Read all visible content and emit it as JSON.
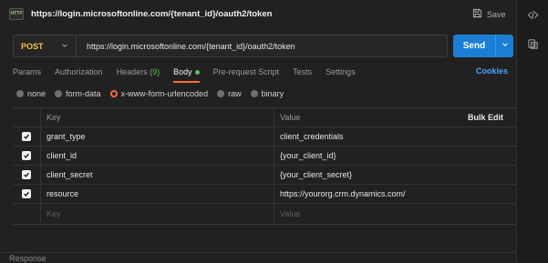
{
  "header": {
    "app_icon_text": "HTTP",
    "request_title": "https://login.microsoftonline.com/{tenant_id}/oauth2/token",
    "save_label": "Save"
  },
  "request": {
    "method": "POST",
    "url": "https://login.microsoftonline.com/{tenant_id}/oauth2/token",
    "send_label": "Send"
  },
  "tabs": [
    {
      "label": "Params"
    },
    {
      "label": "Authorization"
    },
    {
      "label": "Headers",
      "count": "(9)"
    },
    {
      "label": "Body",
      "active": true
    },
    {
      "label": "Pre-request Script"
    },
    {
      "label": "Tests"
    },
    {
      "label": "Settings"
    }
  ],
  "cookies_label": "Cookies",
  "body_types": [
    {
      "label": "none",
      "selected": false
    },
    {
      "label": "form-data",
      "selected": false
    },
    {
      "label": "x-www-form-urlencoded",
      "selected": true
    },
    {
      "label": "raw",
      "selected": false
    },
    {
      "label": "binary",
      "selected": false
    }
  ],
  "table": {
    "headers": {
      "key": "Key",
      "value": "Value",
      "bulk_edit": "Bulk Edit"
    },
    "rows": [
      {
        "key": "grant_type",
        "value": "client_credentials",
        "checked": true
      },
      {
        "key": "client_id",
        "value": "{your_client_id}",
        "checked": true
      },
      {
        "key": "client_secret",
        "value": "{your_client_secret}",
        "checked": true
      },
      {
        "key": "resource",
        "value": "https://yourorg.crm.dynamics.com/",
        "checked": true
      }
    ],
    "placeholder": {
      "key": "Key",
      "value": "Value"
    }
  },
  "response_label": "Response",
  "colors": {
    "accent": "#ff6c37",
    "method": "#f5c242",
    "send": "#1a7fd4",
    "link": "#4aa3ff",
    "badge": "#5fbf5f"
  },
  "icons": {
    "save": "save-icon",
    "code": "code-icon",
    "info": "info-icon",
    "chevron": "chevron-down-icon",
    "check": "check-icon"
  }
}
